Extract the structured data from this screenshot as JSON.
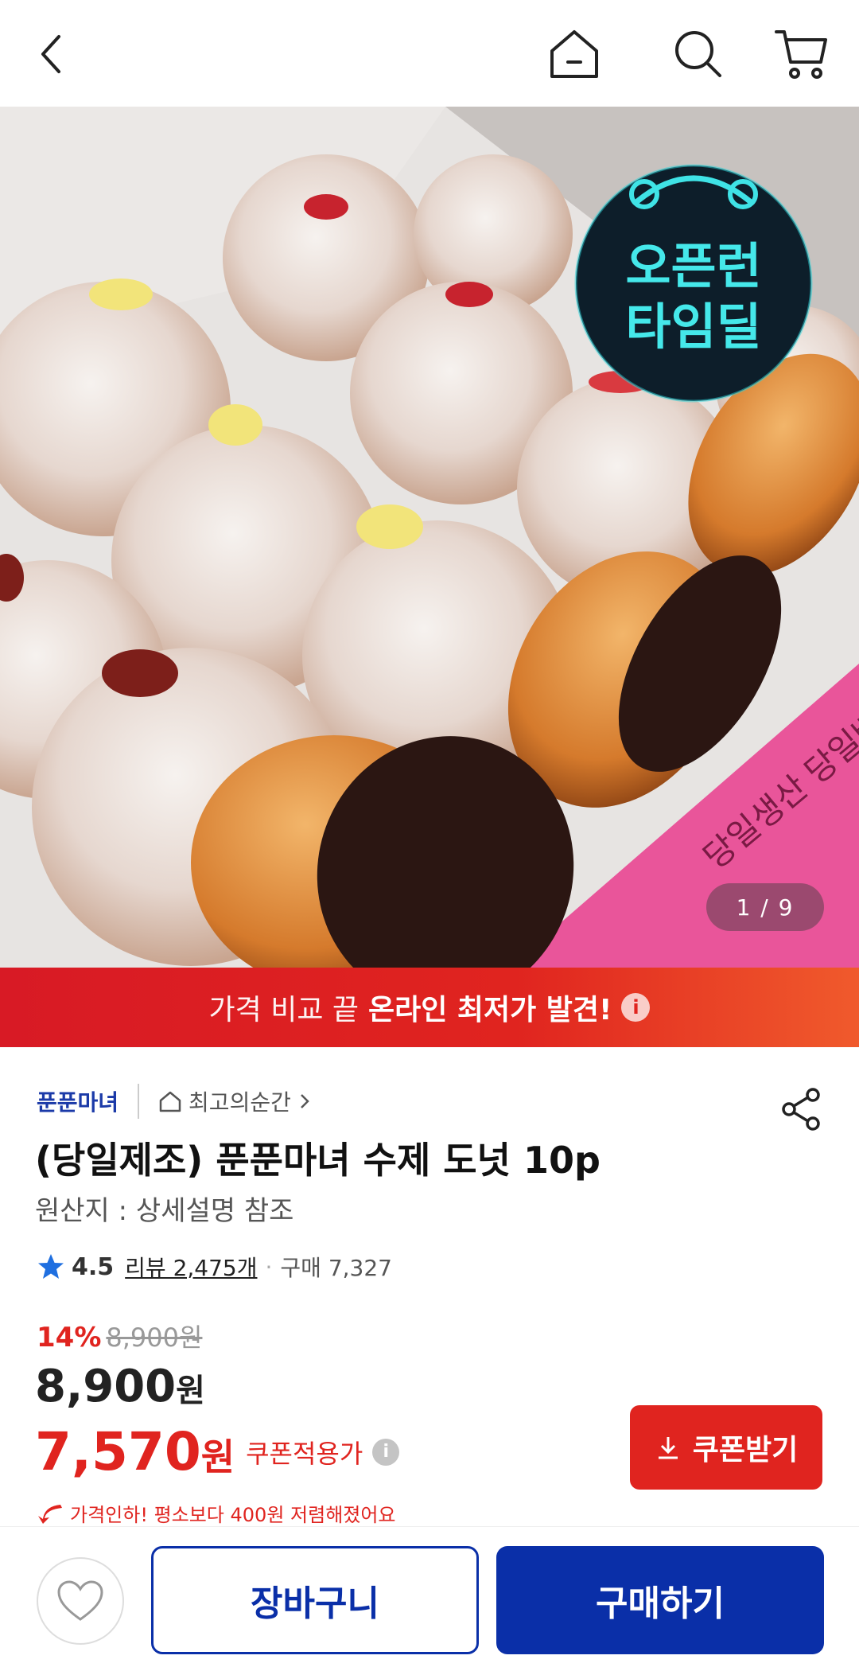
{
  "header": {
    "back_icon": "chevron-left-icon",
    "home_icon": "home-icon",
    "search_icon": "search-icon",
    "cart_icon": "cart-icon"
  },
  "gallery": {
    "badge_line1": "오픈런",
    "badge_line2": "타임딜",
    "box_text": "당일생산 당일배송",
    "page_indicator": "1 / 9"
  },
  "banner": {
    "text_normal": "가격 비교 끝",
    "text_strong": "온라인 최저가 발견!",
    "info_icon": "i"
  },
  "product": {
    "shop_name": "푼푼마녀",
    "shop_link": "최고의순간",
    "title": "(당일제조) 푼푼마녀 수제 도넛 10p",
    "origin": "원산지 : 상세설명 참조",
    "rating": "4.5",
    "review": "리뷰 2,475개",
    "purchase": "구매 7,327",
    "discount": "14%",
    "original_price": "8,900원",
    "price_number": "8,900",
    "price_unit": "원",
    "coupon_price_number": "7,570",
    "coupon_price_unit": "원",
    "coupon_label": "쿠폰적용가",
    "coupon_button": "쿠폰받기",
    "price_drop_note": "가격인하! 평소보다 400원 저렴해졌어요"
  },
  "bottom_bar": {
    "cart_button": "장바구니",
    "buy_button": "구매하기"
  },
  "colors": {
    "accent_red": "#e0241f",
    "brand_blue": "#0a2fa8",
    "star_blue": "#1f6fe0"
  }
}
